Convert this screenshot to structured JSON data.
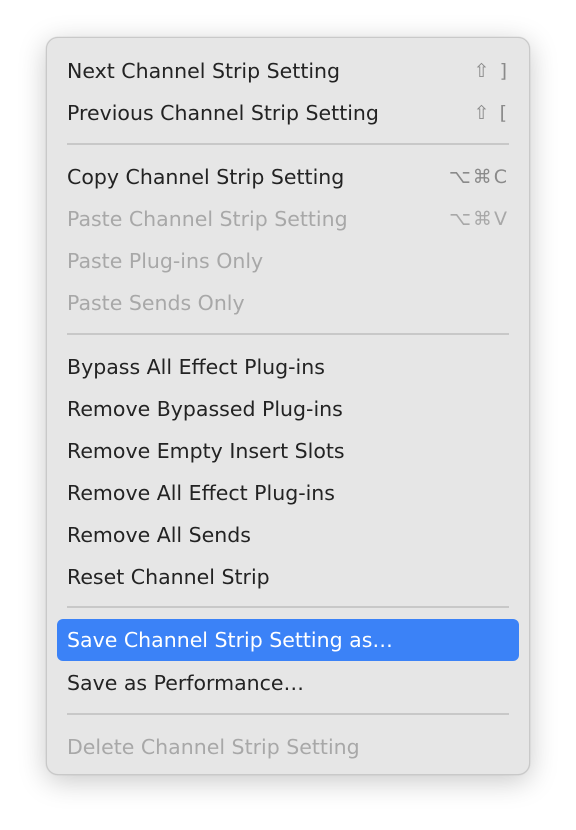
{
  "menu": {
    "items": [
      {
        "label": "Next Channel Strip Setting",
        "shortcut": "⇧ ]"
      },
      {
        "label": "Previous Channel Strip Setting",
        "shortcut": "⇧ ["
      },
      {
        "label": "Copy Channel Strip Setting",
        "shortcut": "⌥⌘C"
      },
      {
        "label": "Paste Channel Strip Setting",
        "shortcut": "⌥⌘V"
      },
      {
        "label": "Paste Plug-ins Only"
      },
      {
        "label": "Paste Sends Only"
      },
      {
        "label": "Bypass All Effect Plug-ins"
      },
      {
        "label": "Remove Bypassed Plug-ins"
      },
      {
        "label": "Remove Empty Insert Slots"
      },
      {
        "label": "Remove All Effect Plug-ins"
      },
      {
        "label": "Remove All Sends"
      },
      {
        "label": "Reset Channel Strip"
      },
      {
        "label": "Save Channel Strip Setting as…"
      },
      {
        "label": "Save as Performance…"
      },
      {
        "label": "Delete Channel Strip Setting"
      }
    ]
  },
  "colors": {
    "menu_background": "#e6e6e6",
    "highlight": "#3b82f7",
    "disabled_text": "#a8a8a8"
  }
}
